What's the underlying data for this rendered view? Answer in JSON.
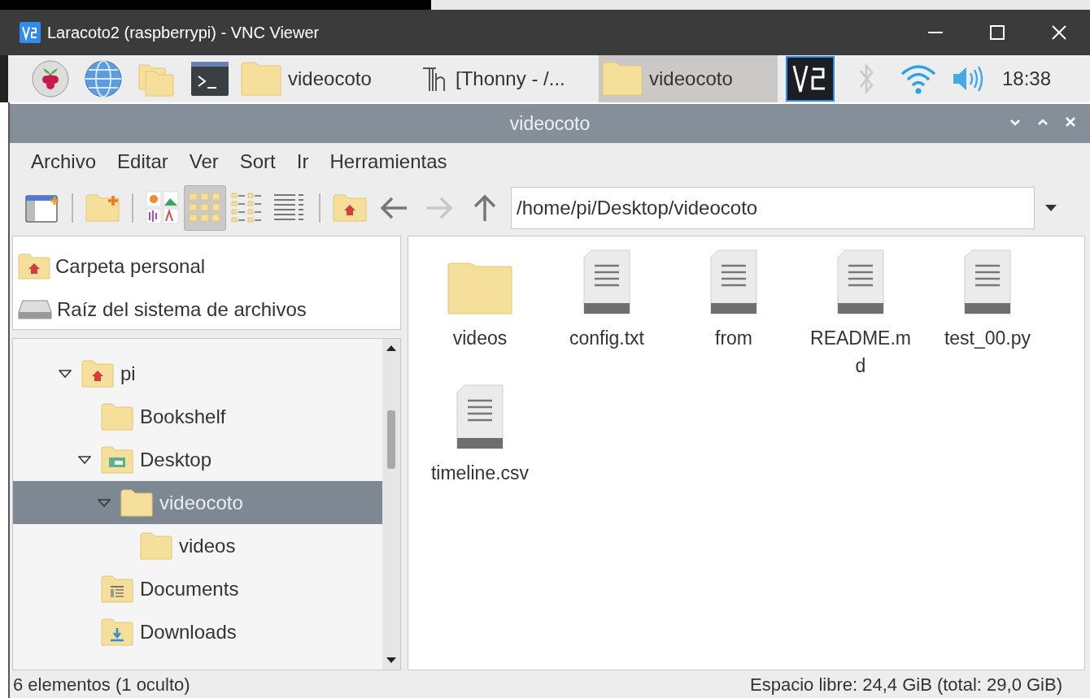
{
  "vnc_window": {
    "title": "Laracoto2 (raspberrypi) - VNC Viewer"
  },
  "taskbar": {
    "launchers": [
      {
        "kind": "raspberry"
      },
      {
        "kind": "browser"
      },
      {
        "kind": "files"
      },
      {
        "kind": "terminal"
      }
    ],
    "tasks": [
      {
        "label": "videocoto",
        "kind": "folder",
        "selected": false
      },
      {
        "label": "[Thonny  - /...",
        "kind": "thonny",
        "selected": false
      },
      {
        "label": "videocoto",
        "kind": "folder",
        "selected": true
      }
    ],
    "clock": "18:38"
  },
  "file_manager": {
    "title": "videocoto",
    "menu": [
      "Archivo",
      "Editar",
      "Ver",
      "Sort",
      "Ir",
      "Herramientas"
    ],
    "view_modes": [
      {
        "kind": "thumbnails",
        "selected": false
      },
      {
        "kind": "icons",
        "selected": true
      },
      {
        "kind": "compact",
        "selected": false
      },
      {
        "kind": "details",
        "selected": false
      }
    ],
    "navigation": [
      {
        "kind": "back",
        "disabled": false
      },
      {
        "kind": "forward",
        "disabled": true
      },
      {
        "kind": "up",
        "disabled": false
      }
    ],
    "path": "/home/pi/Desktop/videocoto",
    "places": [
      {
        "label": "Carpeta personal",
        "kind": "home"
      },
      {
        "label": "Raíz del sistema de archivos",
        "kind": "drive"
      }
    ],
    "tree": [
      {
        "label": "pi",
        "kind": "home",
        "expanded": true,
        "selected": false,
        "children": [
          {
            "label": "Bookshelf",
            "kind": "folder",
            "selected": false
          },
          {
            "label": "Desktop",
            "kind": "desktop",
            "expanded": true,
            "selected": false,
            "children": [
              {
                "label": "videocoto",
                "kind": "folder",
                "expanded": true,
                "selected": true,
                "children": [
                  {
                    "label": "videos",
                    "kind": "folder",
                    "selected": false
                  }
                ]
              }
            ]
          },
          {
            "label": "Documents",
            "kind": "documents",
            "selected": false
          },
          {
            "label": "Downloads",
            "kind": "downloads",
            "selected": false
          }
        ]
      }
    ],
    "files": [
      {
        "name": "videos",
        "kind": "folder"
      },
      {
        "name": "config.txt",
        "kind": "text"
      },
      {
        "name": "from",
        "kind": "text"
      },
      {
        "name": "README.md",
        "kind": "text"
      },
      {
        "name": "test_00.py",
        "kind": "text"
      },
      {
        "name": "timeline.csv",
        "kind": "text"
      }
    ],
    "status_bar": {
      "items": "6 elementos (1 oculto)",
      "free_space": "Espacio libre: 24,4 GiB (total: 29,0 GiB)"
    }
  }
}
